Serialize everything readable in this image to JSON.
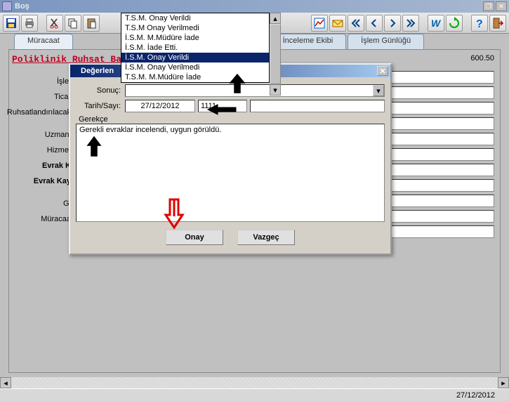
{
  "window": {
    "title": "Boş"
  },
  "toolbar": {
    "icons": [
      "save",
      "print",
      "cut",
      "copy",
      "paste",
      "chart",
      "mail",
      "first",
      "prev",
      "next",
      "last",
      "w",
      "refresh",
      "help",
      "exit"
    ]
  },
  "tabs": {
    "t1": "Müracaat",
    "t3": "Yerinde İnceleme Ekibi",
    "t4": "İşlem Günlüğü"
  },
  "page": {
    "title": "Poliklinik Ruhsat Ba",
    "number": "600.50"
  },
  "form_labels": {
    "l1": "İşlet",
    "l2": "Ticar",
    "l3": "Ruhsatlandırılacak",
    "l4": "Uzmanl",
    "l5": "Hizmet",
    "l6": "Evrak K",
    "l7": "Evrak Kay",
    "l8": "Gi",
    "l9": "Müracaa"
  },
  "dropdown": {
    "items": [
      "T.S.M. Onay Verildi",
      "T.S.M Onay Verilmedi",
      "İ.S.M. M.Müdüre İade",
      "İ.S.M. İade Etti.",
      "İ.S.M. Onay Verildi",
      "İ.S.M. Onay Verilmedi",
      "T.S.M. M.Müdüre İade"
    ],
    "selected_index": 4
  },
  "modal": {
    "title": "Değerlen",
    "sonuc_label": "Sonuç:",
    "tarih_label": "Tarih/Sayı:",
    "tarih_value": "27/12/2012",
    "sayi_value": "1111",
    "gerekce_label": "Gerekçe",
    "gerekce_value": "Gerekli evraklar incelendi, uygun görüldü.",
    "onay": "Onay",
    "vazgec": "Vazgeç"
  },
  "status": {
    "date": "27/12/2012"
  }
}
